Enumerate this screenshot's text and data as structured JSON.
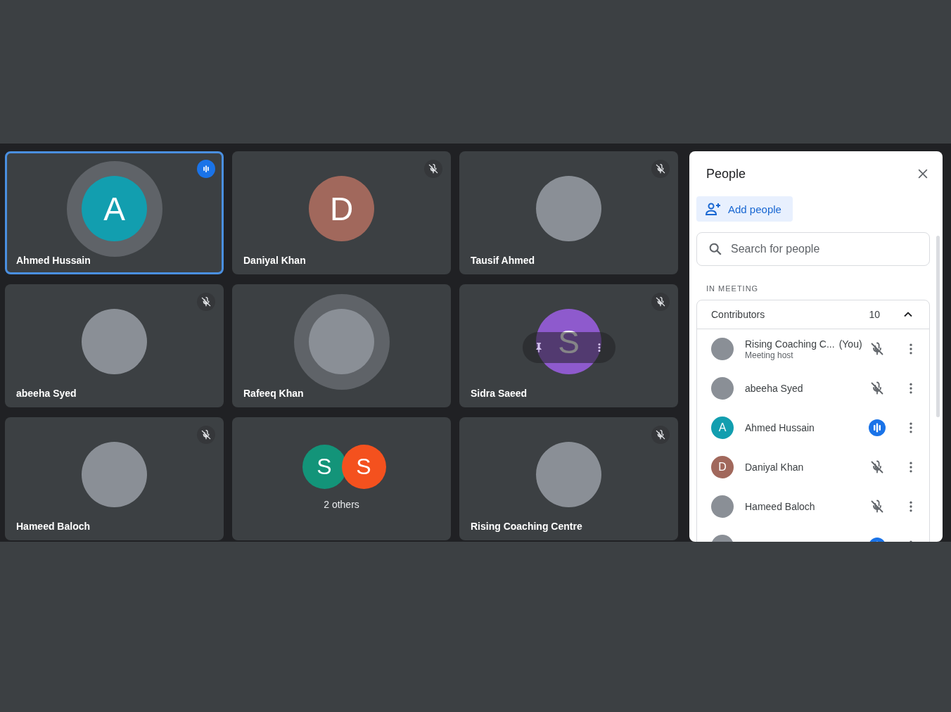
{
  "tiles": [
    {
      "name": "Ahmed Hussain",
      "kind": "letter",
      "letter": "A",
      "color": "#129eaf",
      "talking": true,
      "ring": true,
      "selected": true,
      "hover": false
    },
    {
      "name": "Daniyal Khan",
      "kind": "letter",
      "letter": "D",
      "color": "#a1685c",
      "muted": true,
      "talking": false,
      "ring": false,
      "selected": false,
      "hover": false
    },
    {
      "name": "Tausif Ahmed",
      "kind": "photo",
      "muted": true,
      "talking": false,
      "ring": false,
      "selected": false,
      "hover": false
    },
    {
      "name": "abeeha Syed",
      "kind": "photo",
      "muted": true,
      "talking": false,
      "ring": false,
      "selected": false,
      "hover": false
    },
    {
      "name": "Rafeeq Khan",
      "kind": "photo",
      "muted": false,
      "talking": false,
      "ring": true,
      "selected": false,
      "hover": false
    },
    {
      "name": "Sidra Saeed",
      "kind": "letter",
      "letter": "S",
      "color": "#8e5acd",
      "muted": true,
      "talking": false,
      "ring": false,
      "selected": false,
      "hover": true
    },
    {
      "name": "Hameed Baloch",
      "kind": "photo",
      "muted": true,
      "talking": false,
      "ring": false,
      "selected": false,
      "hover": false
    },
    {
      "kind": "others",
      "letters": [
        {
          "letter": "S",
          "color": "#139479"
        },
        {
          "letter": "S",
          "color": "#f4511e"
        }
      ],
      "caption": "2 others",
      "muted": false,
      "talking": false,
      "selected": false,
      "hover": false
    },
    {
      "name": "Rising Coaching Centre",
      "kind": "photo",
      "muted": true,
      "talking": false,
      "ring": false,
      "selected": false,
      "hover": false
    }
  ],
  "panel": {
    "title": "People",
    "add_button": "Add people",
    "search": {
      "placeholder": "Search for people"
    },
    "section": "IN MEETING",
    "group": {
      "label": "Contributors",
      "count": "10",
      "expanded": true
    },
    "people": [
      {
        "name": "Rising Coaching C...",
        "suffix": "(You)",
        "subtitle": "Meeting host",
        "kind": "photo",
        "muted": true,
        "talking": false
      },
      {
        "name": "abeeha Syed",
        "kind": "photo",
        "muted": true,
        "talking": false
      },
      {
        "name": "Ahmed Hussain",
        "kind": "letter",
        "letter": "A",
        "color": "#129eaf",
        "talking": true
      },
      {
        "name": "Daniyal Khan",
        "kind": "letter",
        "letter": "D",
        "color": "#a1685c",
        "muted": true,
        "talking": false
      },
      {
        "name": "Hameed Baloch",
        "kind": "photo",
        "muted": true,
        "talking": false
      },
      {
        "kind": "photo",
        "talking": true
      }
    ]
  }
}
